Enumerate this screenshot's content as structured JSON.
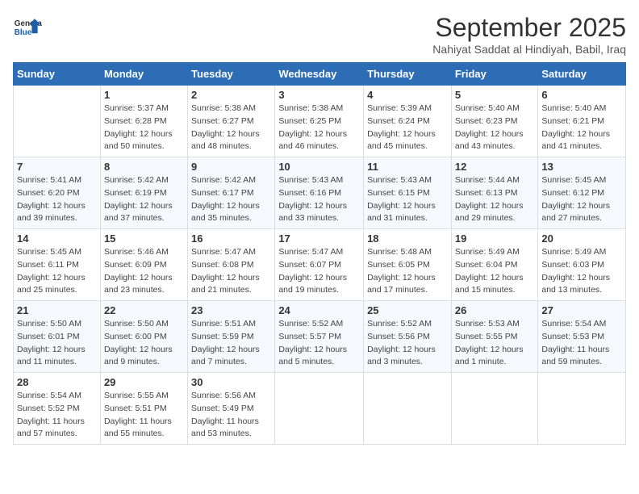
{
  "header": {
    "logo_general": "General",
    "logo_blue": "Blue",
    "month": "September 2025",
    "location": "Nahiyat Saddat al Hindiyah, Babil, Iraq"
  },
  "columns": [
    "Sunday",
    "Monday",
    "Tuesday",
    "Wednesday",
    "Thursday",
    "Friday",
    "Saturday"
  ],
  "weeks": [
    [
      {
        "day": "",
        "info": ""
      },
      {
        "day": "1",
        "info": "Sunrise: 5:37 AM\nSunset: 6:28 PM\nDaylight: 12 hours\nand 50 minutes."
      },
      {
        "day": "2",
        "info": "Sunrise: 5:38 AM\nSunset: 6:27 PM\nDaylight: 12 hours\nand 48 minutes."
      },
      {
        "day": "3",
        "info": "Sunrise: 5:38 AM\nSunset: 6:25 PM\nDaylight: 12 hours\nand 46 minutes."
      },
      {
        "day": "4",
        "info": "Sunrise: 5:39 AM\nSunset: 6:24 PM\nDaylight: 12 hours\nand 45 minutes."
      },
      {
        "day": "5",
        "info": "Sunrise: 5:40 AM\nSunset: 6:23 PM\nDaylight: 12 hours\nand 43 minutes."
      },
      {
        "day": "6",
        "info": "Sunrise: 5:40 AM\nSunset: 6:21 PM\nDaylight: 12 hours\nand 41 minutes."
      }
    ],
    [
      {
        "day": "7",
        "info": "Sunrise: 5:41 AM\nSunset: 6:20 PM\nDaylight: 12 hours\nand 39 minutes."
      },
      {
        "day": "8",
        "info": "Sunrise: 5:42 AM\nSunset: 6:19 PM\nDaylight: 12 hours\nand 37 minutes."
      },
      {
        "day": "9",
        "info": "Sunrise: 5:42 AM\nSunset: 6:17 PM\nDaylight: 12 hours\nand 35 minutes."
      },
      {
        "day": "10",
        "info": "Sunrise: 5:43 AM\nSunset: 6:16 PM\nDaylight: 12 hours\nand 33 minutes."
      },
      {
        "day": "11",
        "info": "Sunrise: 5:43 AM\nSunset: 6:15 PM\nDaylight: 12 hours\nand 31 minutes."
      },
      {
        "day": "12",
        "info": "Sunrise: 5:44 AM\nSunset: 6:13 PM\nDaylight: 12 hours\nand 29 minutes."
      },
      {
        "day": "13",
        "info": "Sunrise: 5:45 AM\nSunset: 6:12 PM\nDaylight: 12 hours\nand 27 minutes."
      }
    ],
    [
      {
        "day": "14",
        "info": "Sunrise: 5:45 AM\nSunset: 6:11 PM\nDaylight: 12 hours\nand 25 minutes."
      },
      {
        "day": "15",
        "info": "Sunrise: 5:46 AM\nSunset: 6:09 PM\nDaylight: 12 hours\nand 23 minutes."
      },
      {
        "day": "16",
        "info": "Sunrise: 5:47 AM\nSunset: 6:08 PM\nDaylight: 12 hours\nand 21 minutes."
      },
      {
        "day": "17",
        "info": "Sunrise: 5:47 AM\nSunset: 6:07 PM\nDaylight: 12 hours\nand 19 minutes."
      },
      {
        "day": "18",
        "info": "Sunrise: 5:48 AM\nSunset: 6:05 PM\nDaylight: 12 hours\nand 17 minutes."
      },
      {
        "day": "19",
        "info": "Sunrise: 5:49 AM\nSunset: 6:04 PM\nDaylight: 12 hours\nand 15 minutes."
      },
      {
        "day": "20",
        "info": "Sunrise: 5:49 AM\nSunset: 6:03 PM\nDaylight: 12 hours\nand 13 minutes."
      }
    ],
    [
      {
        "day": "21",
        "info": "Sunrise: 5:50 AM\nSunset: 6:01 PM\nDaylight: 12 hours\nand 11 minutes."
      },
      {
        "day": "22",
        "info": "Sunrise: 5:50 AM\nSunset: 6:00 PM\nDaylight: 12 hours\nand 9 minutes."
      },
      {
        "day": "23",
        "info": "Sunrise: 5:51 AM\nSunset: 5:59 PM\nDaylight: 12 hours\nand 7 minutes."
      },
      {
        "day": "24",
        "info": "Sunrise: 5:52 AM\nSunset: 5:57 PM\nDaylight: 12 hours\nand 5 minutes."
      },
      {
        "day": "25",
        "info": "Sunrise: 5:52 AM\nSunset: 5:56 PM\nDaylight: 12 hours\nand 3 minutes."
      },
      {
        "day": "26",
        "info": "Sunrise: 5:53 AM\nSunset: 5:55 PM\nDaylight: 12 hours\nand 1 minute."
      },
      {
        "day": "27",
        "info": "Sunrise: 5:54 AM\nSunset: 5:53 PM\nDaylight: 11 hours\nand 59 minutes."
      }
    ],
    [
      {
        "day": "28",
        "info": "Sunrise: 5:54 AM\nSunset: 5:52 PM\nDaylight: 11 hours\nand 57 minutes."
      },
      {
        "day": "29",
        "info": "Sunrise: 5:55 AM\nSunset: 5:51 PM\nDaylight: 11 hours\nand 55 minutes."
      },
      {
        "day": "30",
        "info": "Sunrise: 5:56 AM\nSunset: 5:49 PM\nDaylight: 11 hours\nand 53 minutes."
      },
      {
        "day": "",
        "info": ""
      },
      {
        "day": "",
        "info": ""
      },
      {
        "day": "",
        "info": ""
      },
      {
        "day": "",
        "info": ""
      }
    ]
  ]
}
